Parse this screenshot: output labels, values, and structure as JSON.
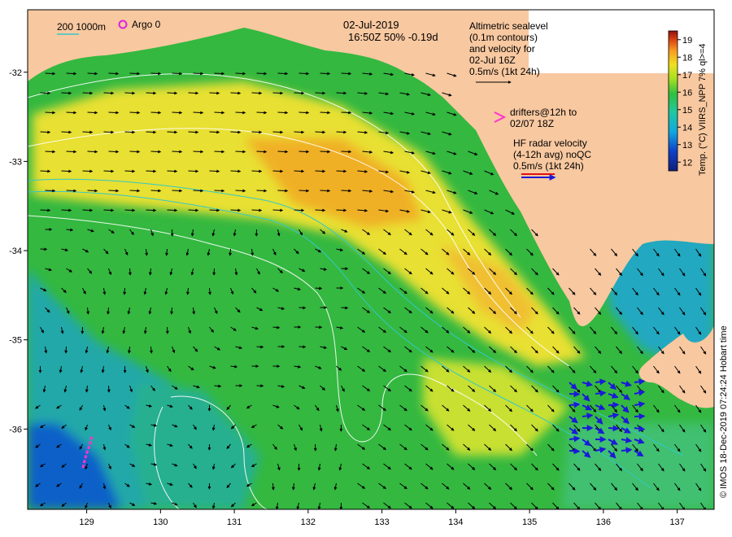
{
  "header": {
    "date": "02-Jul-2019",
    "time_line": "16:50Z  50% -0.19d",
    "depth_legend": "200  1000m",
    "argo_label": "Argo 0"
  },
  "legend": {
    "altimetry_lines": [
      "Altimetric sealevel",
      "(0.1m contours)",
      "and velocity for",
      "02-Jul 16Z",
      "0.5m/s (1kt 24h)"
    ],
    "drifters_lines": [
      "drifters@12h to",
      "02/07 18Z"
    ],
    "hf_lines": [
      "HF radar velocity",
      "(4-12h avg) noQC",
      "0.5m/s (1kt 24h)"
    ]
  },
  "colorbar": {
    "label": "Temp. (°C) VIIRS_NPP 7% ql>=4",
    "min": 11.5,
    "max": 19.5,
    "ticks": [
      "12",
      "13",
      "14",
      "15",
      "16",
      "17",
      "18",
      "19"
    ]
  },
  "axes": {
    "x_ticks": [
      "129",
      "130",
      "131",
      "132",
      "133",
      "134",
      "135",
      "136",
      "137"
    ],
    "y_ticks": [
      "-32",
      "-33",
      "-34",
      "-35",
      "-36"
    ],
    "lon_range": [
      128.2,
      137.5
    ],
    "lat_range": [
      -36.9,
      -31.3
    ]
  },
  "credit": "© IMOS 18-Dec-2019 07:24:24 Hobart time",
  "colors": {
    "land": "#f8c8a0",
    "altimetry_arrow": "#000000",
    "hf_arrow": "#1a1ad8",
    "drifter": "#ff33cc",
    "depth_contour": "#33c8c8",
    "sealevel_contour": "#ffffff"
  }
}
